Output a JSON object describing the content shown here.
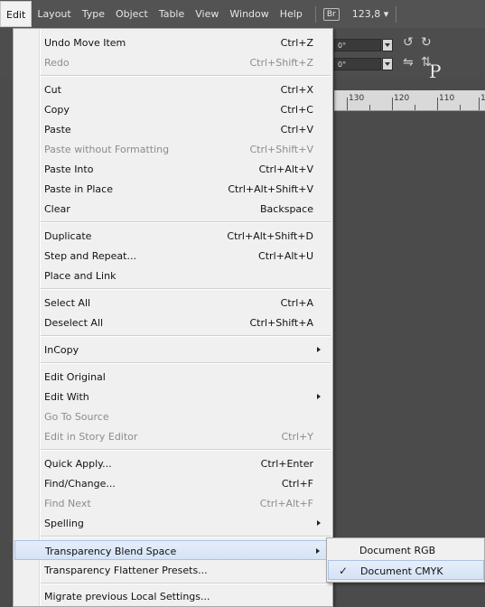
{
  "menubar": {
    "items": [
      "Edit",
      "Layout",
      "Type",
      "Object",
      "Table",
      "View",
      "Window",
      "Help"
    ],
    "bridge_badge": "Br",
    "zoom": "123,8 ▾"
  },
  "control": {
    "angle1": "0°",
    "angle2": "0°"
  },
  "ruler": {
    "labels": [
      "130",
      "120",
      "110",
      "1"
    ]
  },
  "edit_menu": {
    "items": [
      {
        "label": "Undo Move Item",
        "shortcut": "Ctrl+Z",
        "disabled": false
      },
      {
        "label": "Redo",
        "shortcut": "Ctrl+Shift+Z",
        "disabled": true
      },
      {
        "label": "Cut",
        "shortcut": "Ctrl+X",
        "disabled": false
      },
      {
        "label": "Copy",
        "shortcut": "Ctrl+C",
        "disabled": false
      },
      {
        "label": "Paste",
        "shortcut": "Ctrl+V",
        "disabled": false
      },
      {
        "label": "Paste without Formatting",
        "shortcut": "Ctrl+Shift+V",
        "disabled": true
      },
      {
        "label": "Paste Into",
        "shortcut": "Ctrl+Alt+V",
        "disabled": false
      },
      {
        "label": "Paste in Place",
        "shortcut": "Ctrl+Alt+Shift+V",
        "disabled": false
      },
      {
        "label": "Clear",
        "shortcut": "Backspace",
        "disabled": false
      },
      {
        "label": "Duplicate",
        "shortcut": "Ctrl+Alt+Shift+D",
        "disabled": false
      },
      {
        "label": "Step and Repeat...",
        "shortcut": "Ctrl+Alt+U",
        "disabled": false
      },
      {
        "label": "Place and Link",
        "shortcut": "",
        "disabled": false
      },
      {
        "label": "Select All",
        "shortcut": "Ctrl+A",
        "disabled": false
      },
      {
        "label": "Deselect All",
        "shortcut": "Ctrl+Shift+A",
        "disabled": false
      },
      {
        "label": "InCopy",
        "shortcut": "",
        "disabled": false,
        "submenu": true
      },
      {
        "label": "Edit Original",
        "shortcut": "",
        "disabled": false
      },
      {
        "label": "Edit With",
        "shortcut": "",
        "disabled": false,
        "submenu": true
      },
      {
        "label": "Go To Source",
        "shortcut": "",
        "disabled": true
      },
      {
        "label": "Edit in Story Editor",
        "shortcut": "Ctrl+Y",
        "disabled": true
      },
      {
        "label": "Quick Apply...",
        "shortcut": "Ctrl+Enter",
        "disabled": false
      },
      {
        "label": "Find/Change...",
        "shortcut": "Ctrl+F",
        "disabled": false
      },
      {
        "label": "Find Next",
        "shortcut": "Ctrl+Alt+F",
        "disabled": true
      },
      {
        "label": "Spelling",
        "shortcut": "",
        "disabled": false,
        "submenu": true
      },
      {
        "label": "Transparency Blend Space",
        "shortcut": "",
        "disabled": false,
        "submenu": true,
        "highlighted": true
      },
      {
        "label": "Transparency Flattener Presets...",
        "shortcut": "",
        "disabled": false
      },
      {
        "label": "Migrate previous Local Settings...",
        "shortcut": "",
        "disabled": false
      }
    ]
  },
  "blend_submenu": {
    "items": [
      {
        "label": "Document RGB",
        "checked": false
      },
      {
        "label": "Document CMYK",
        "checked": true
      }
    ],
    "check_glyph": "✓"
  }
}
